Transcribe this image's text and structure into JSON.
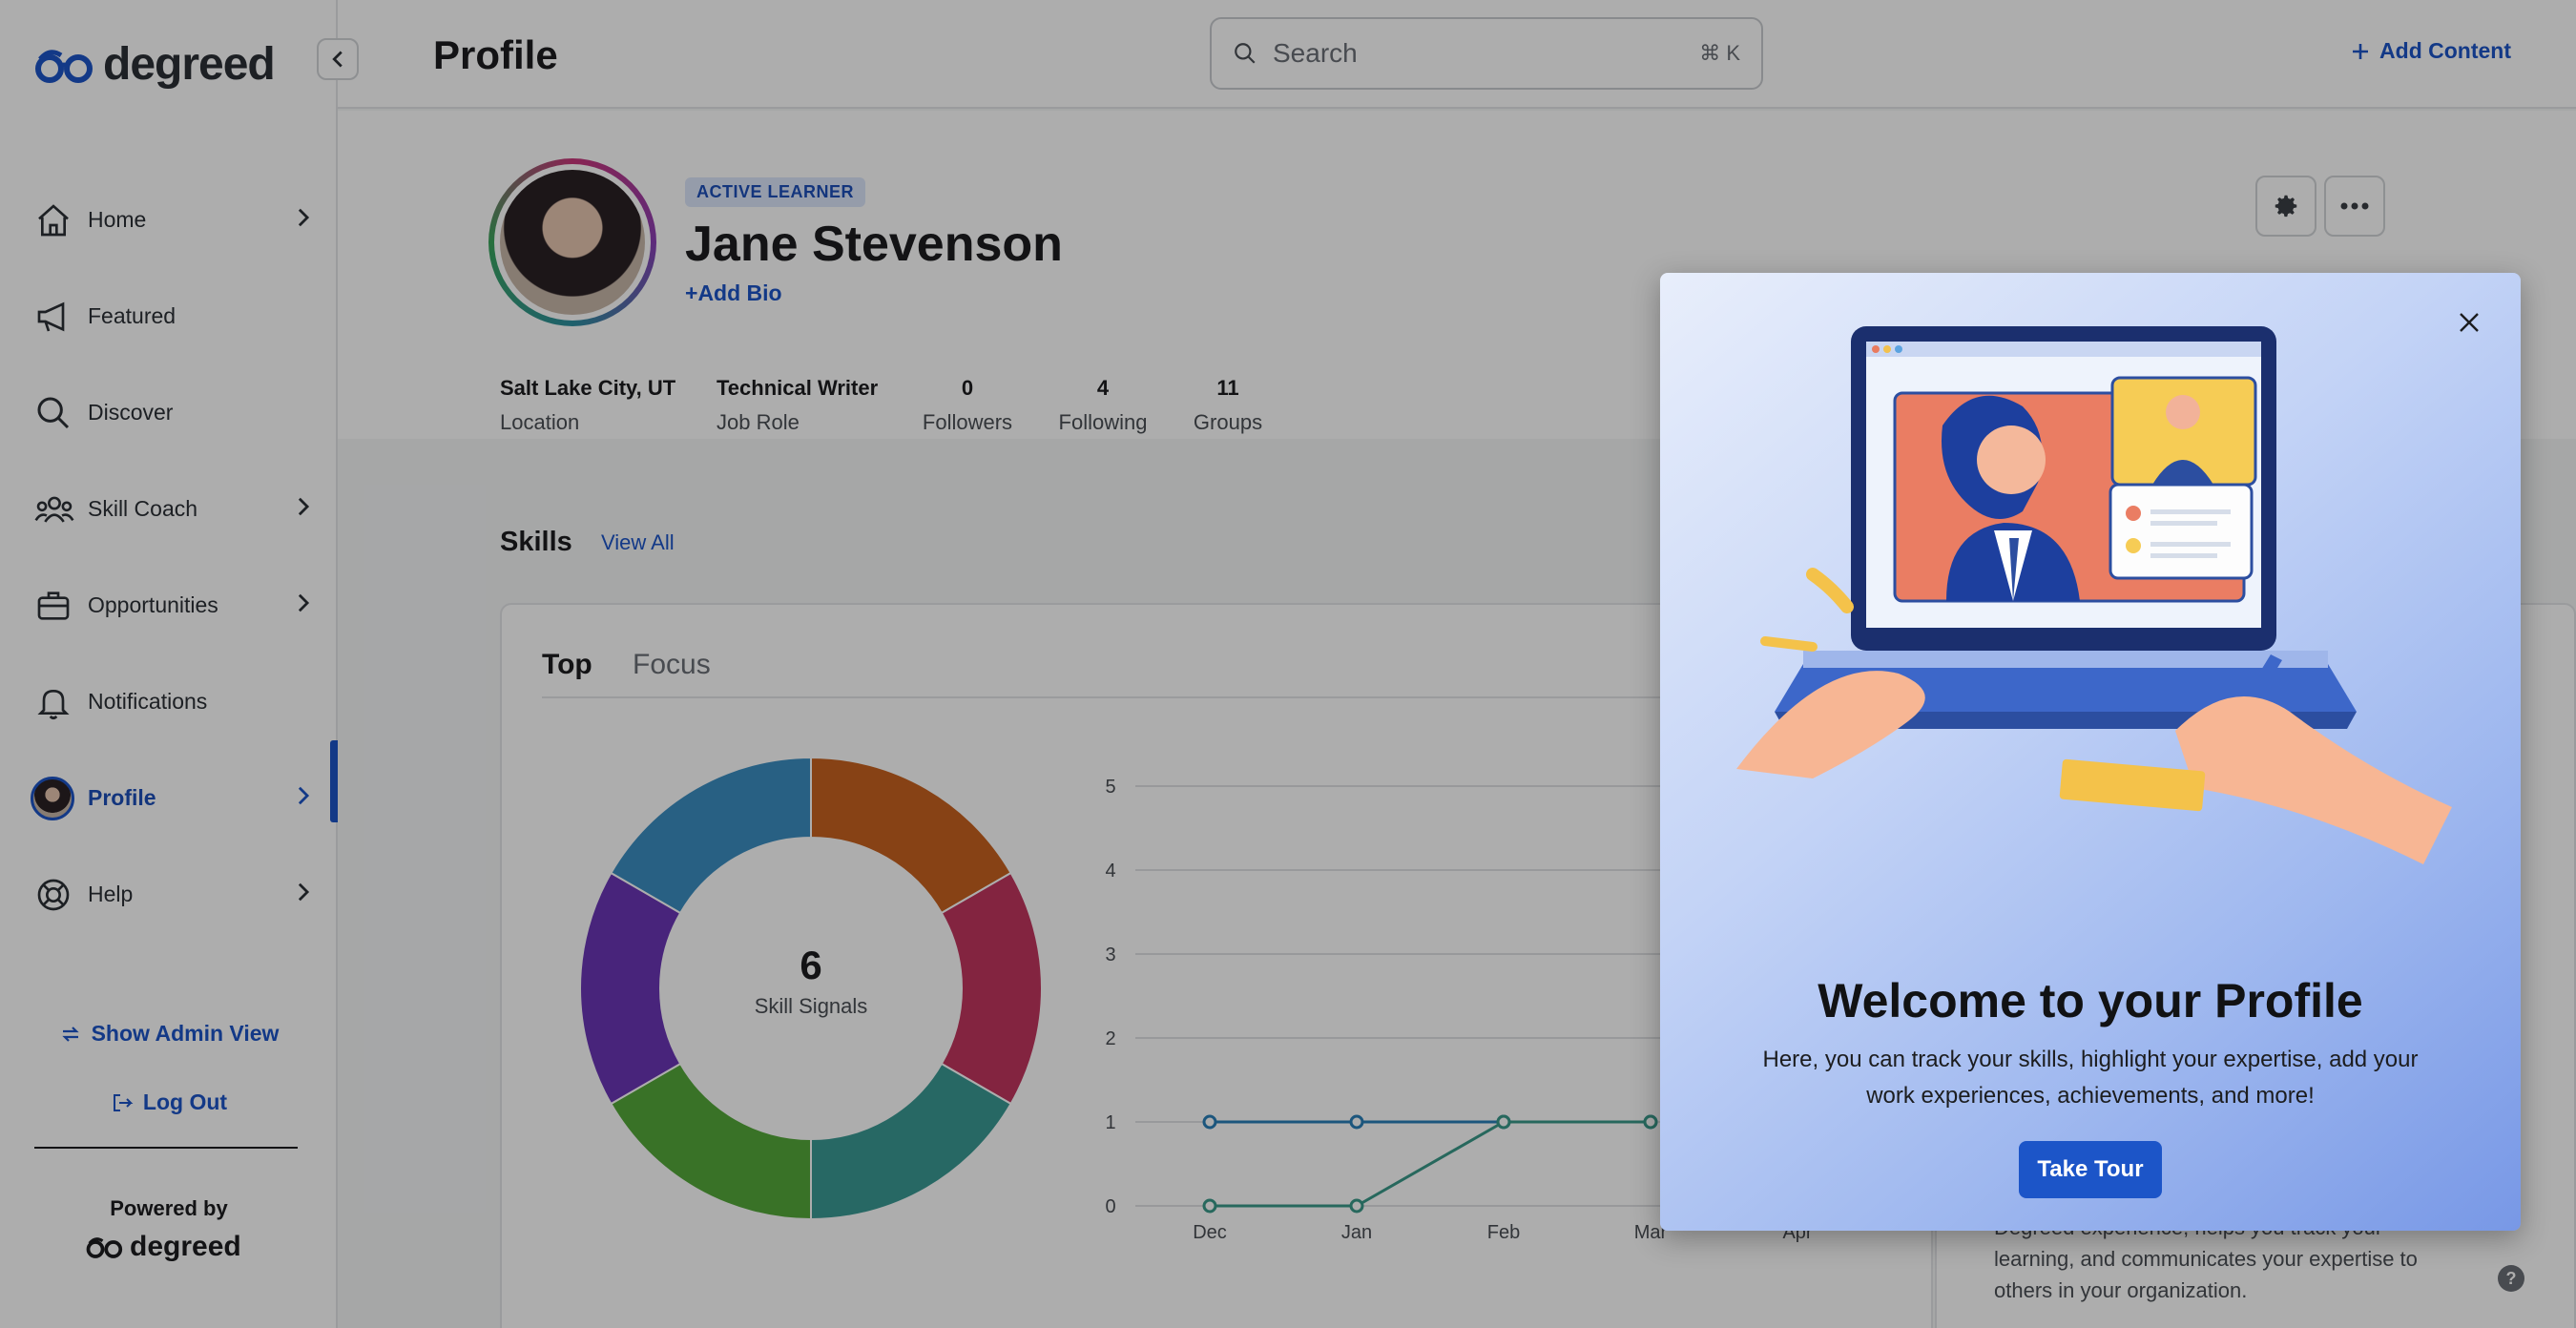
{
  "app": {
    "logo_text": "degreed"
  },
  "header": {
    "page_title": "Profile",
    "search_placeholder": "Search",
    "search_shortcut": "⌘ K",
    "add_content_label": "Add Content"
  },
  "sidebar": {
    "items": [
      {
        "label": "Home",
        "icon": "home-icon",
        "has_chevron": true
      },
      {
        "label": "Featured",
        "icon": "megaphone-icon",
        "has_chevron": false
      },
      {
        "label": "Discover",
        "icon": "search-icon",
        "has_chevron": false
      },
      {
        "label": "Skill Coach",
        "icon": "people-icon",
        "has_chevron": true
      },
      {
        "label": "Opportunities",
        "icon": "briefcase-icon",
        "has_chevron": true
      },
      {
        "label": "Notifications",
        "icon": "bell-icon",
        "has_chevron": false
      },
      {
        "label": "Profile",
        "icon": "avatar",
        "has_chevron": true,
        "active": true
      },
      {
        "label": "Help",
        "icon": "lifebuoy-icon",
        "has_chevron": true
      }
    ],
    "show_admin_label": "Show Admin View",
    "logout_label": "Log Out",
    "powered_by_label": "Powered by",
    "powered_logo_text": "degreed"
  },
  "profile": {
    "badge": "ACTIVE LEARNER",
    "name": "Jane Stevenson",
    "add_bio_label": "Add Bio",
    "stats": [
      {
        "value": "Salt Lake City, UT",
        "label": "Location"
      },
      {
        "value": "Technical Writer",
        "label": "Job Role"
      },
      {
        "value": "0",
        "label": "Followers"
      },
      {
        "value": "4",
        "label": "Following"
      },
      {
        "value": "11",
        "label": "Groups"
      }
    ]
  },
  "skills": {
    "title": "Skills",
    "view_all_label": "View All",
    "tabs": [
      "Top",
      "Focus"
    ],
    "active_tab": "Top",
    "donut_value": "6",
    "donut_label": "Skill Signals",
    "right_card_text": "Degreed experience, helps you track your learning, and communicates your expertise to others in your organization."
  },
  "chart_data": [
    {
      "type": "pie",
      "values": [
        1,
        1,
        1,
        1,
        1,
        1
      ],
      "colors": [
        "#c7621f",
        "#c2355f",
        "#3a9a94",
        "#55a83a",
        "#6a35b6",
        "#3b8ec2"
      ]
    },
    {
      "type": "line",
      "x": [
        "Dec",
        "Jan",
        "Feb",
        "Mar",
        "Apr"
      ],
      "ylim": [
        0,
        5
      ],
      "yticks": [
        "0",
        "1",
        "2",
        "3",
        "4",
        "5"
      ],
      "series": [
        {
          "values": [
            1,
            1,
            1,
            1
          ],
          "color": "#2a7fb8"
        },
        {
          "values": [
            0,
            0,
            1,
            1
          ],
          "color": "#3a9a8a"
        }
      ]
    }
  ],
  "modal": {
    "title": "Welcome to your Profile",
    "body": "Here, you can track your skills, highlight your expertise, add your work experiences, achievements, and more!",
    "button_label": "Take Tour"
  },
  "colors": {
    "brand": "#1c55c8",
    "text": "#1c1d1f"
  }
}
